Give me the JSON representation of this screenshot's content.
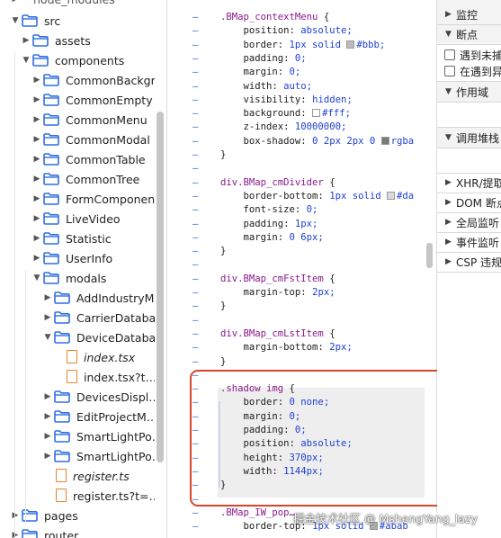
{
  "sidebar": {
    "top_partial": "node_modules",
    "items": [
      {
        "label": "src",
        "type": "folder",
        "expanded": true
      },
      {
        "label": "assets",
        "type": "folder",
        "expanded": false
      },
      {
        "label": "components",
        "type": "folder",
        "expanded": true
      },
      {
        "label": "CommonBackgr…",
        "type": "folder",
        "expanded": false
      },
      {
        "label": "CommonEmpty",
        "type": "folder",
        "expanded": false
      },
      {
        "label": "CommonMenu",
        "type": "folder",
        "expanded": false
      },
      {
        "label": "CommonModal",
        "type": "folder",
        "expanded": false
      },
      {
        "label": "CommonTable",
        "type": "folder",
        "expanded": false
      },
      {
        "label": "CommonTree",
        "type": "folder",
        "expanded": false
      },
      {
        "label": "FormComponent",
        "type": "folder",
        "expanded": false
      },
      {
        "label": "LiveVideo",
        "type": "folder",
        "expanded": false
      },
      {
        "label": "Statistic",
        "type": "folder",
        "expanded": false
      },
      {
        "label": "UserInfo",
        "type": "folder",
        "expanded": false
      },
      {
        "label": "modals",
        "type": "folder",
        "expanded": true
      },
      {
        "label": "AddIndustryM…",
        "type": "folder",
        "expanded": false
      },
      {
        "label": "CarrierDataba…",
        "type": "folder",
        "expanded": false
      },
      {
        "label": "DeviceDataba…",
        "type": "folder",
        "expanded": true
      },
      {
        "label": "index.tsx",
        "type": "file",
        "italic": true
      },
      {
        "label": "index.tsx?t…",
        "type": "file",
        "italic": false
      },
      {
        "label": "DevicesDispl…",
        "type": "folder",
        "expanded": false
      },
      {
        "label": "EditProjectM…",
        "type": "folder",
        "expanded": false
      },
      {
        "label": "SmartLightPo…",
        "type": "folder",
        "expanded": false
      },
      {
        "label": "SmartLightPo…",
        "type": "folder",
        "expanded": false
      },
      {
        "label": "register.ts",
        "type": "file",
        "italic": true
      },
      {
        "label": "register.ts?t=…",
        "type": "file",
        "italic": false
      },
      {
        "label": "pages",
        "type": "folder",
        "expanded": false
      },
      {
        "label": "router",
        "type": "folder",
        "expanded": false
      }
    ]
  },
  "code": {
    "lines": [
      {
        "m": "–",
        "t": ".BMap_contextMenu {",
        "kind": "sel"
      },
      {
        "m": "–",
        "t": "    position: absolute;",
        "kind": "prop",
        "p": "position",
        "v": "absolute"
      },
      {
        "m": "–",
        "t": "    border: 1px solid #bbb;",
        "kind": "prop",
        "p": "border",
        "v": "1px solid",
        "sw": "#bbbbbb",
        "v2": "#bbb;"
      },
      {
        "m": "–",
        "t": "    padding: 0;",
        "kind": "prop",
        "p": "padding",
        "v": "0"
      },
      {
        "m": "–",
        "t": "    margin: 0;",
        "kind": "prop",
        "p": "margin",
        "v": "0"
      },
      {
        "m": "–",
        "t": "    width: auto;",
        "kind": "prop",
        "p": "width",
        "v": "auto"
      },
      {
        "m": "–",
        "t": "    visibility: hidden;",
        "kind": "prop",
        "p": "visibility",
        "v": "hidden"
      },
      {
        "m": "–",
        "t": "    background: #fff;",
        "kind": "prop",
        "p": "background",
        "v": "",
        "sw": "#ffffff",
        "v2": "#fff;"
      },
      {
        "m": "–",
        "t": "    z-index: 10000000;",
        "kind": "prop",
        "p": "z-index",
        "v": "10000000"
      },
      {
        "m": "–",
        "t": "    box-shadow: 0 2px 2px 0 rgba",
        "kind": "prop",
        "p": "box-shadow",
        "v": "0 2px 2px 0",
        "sw": "#7a7a7a",
        "v2": "rgba"
      },
      {
        "m": "–",
        "t": "}",
        "kind": "plain"
      },
      {
        "m": "–",
        "t": "",
        "kind": "plain"
      },
      {
        "m": "–",
        "t": "div.BMap_cmDivider {",
        "kind": "sel"
      },
      {
        "m": "–",
        "t": "    border-bottom: 1px solid #da",
        "kind": "prop",
        "p": "border-bottom",
        "v": "1px solid",
        "sw": "#dadada",
        "v2": "#da"
      },
      {
        "m": "–",
        "t": "    font-size: 0;",
        "kind": "prop",
        "p": "font-size",
        "v": "0"
      },
      {
        "m": "–",
        "t": "    padding: 1px;",
        "kind": "prop",
        "p": "padding",
        "v": "1px"
      },
      {
        "m": "–",
        "t": "    margin: 0 6px;",
        "kind": "prop",
        "p": "margin",
        "v": "0 6px"
      },
      {
        "m": "–",
        "t": "}",
        "kind": "plain"
      },
      {
        "m": "–",
        "t": "",
        "kind": "plain"
      },
      {
        "m": "–",
        "t": "div.BMap_cmFstItem {",
        "kind": "sel"
      },
      {
        "m": "–",
        "t": "    margin-top: 2px;",
        "kind": "prop",
        "p": "margin-top",
        "v": "2px"
      },
      {
        "m": "–",
        "t": "}",
        "kind": "plain"
      },
      {
        "m": "–",
        "t": "",
        "kind": "plain"
      },
      {
        "m": "–",
        "t": "div.BMap_cmLstItem {",
        "kind": "sel"
      },
      {
        "m": "–",
        "t": "    margin-bottom: 2px;",
        "kind": "prop",
        "p": "margin-bottom",
        "v": "2px"
      },
      {
        "m": "–",
        "t": "}",
        "kind": "plain"
      },
      {
        "m": "–",
        "t": "",
        "kind": "plain"
      },
      {
        "m": "–",
        "t": ".shadow img {",
        "kind": "sel"
      },
      {
        "m": "–",
        "t": "    border: 0 none;",
        "kind": "prop",
        "p": "border",
        "v": "0 none"
      },
      {
        "m": "–",
        "t": "    margin: 0;",
        "kind": "prop",
        "p": "margin",
        "v": "0"
      },
      {
        "m": "–",
        "t": "    padding: 0;",
        "kind": "prop",
        "p": "padding",
        "v": "0"
      },
      {
        "m": "–",
        "t": "    position: absolute;",
        "kind": "prop",
        "p": "position",
        "v": "absolute"
      },
      {
        "m": "–",
        "t": "    height: 370px;",
        "kind": "prop",
        "p": "height",
        "v": "370px"
      },
      {
        "m": "–",
        "t": "    width: 1144px;",
        "kind": "prop",
        "p": "width",
        "v": "1144px"
      },
      {
        "m": "–",
        "t": "}",
        "kind": "plain"
      },
      {
        "m": "–",
        "t": "",
        "kind": "plain"
      },
      {
        "m": "–",
        "t": ".BMap_IW_pop…",
        "kind": "sel"
      },
      {
        "m": "–",
        "t": "    border-top: 1px solid #abab",
        "kind": "prop",
        "p": "border-top",
        "v": "1px solid",
        "sw": "#ababab",
        "v2": "#abab"
      }
    ]
  },
  "right_panel": {
    "watch": "监控",
    "breakpoints": "断点",
    "pause_uncaught": "遇到未捕",
    "pause_caught": "在遇到异",
    "scope": "作用域",
    "call_stack": "调用堆栈",
    "xhr": "XHR/提取",
    "dom": "DOM 断点",
    "global": "全局监听",
    "event": "事件监听",
    "csp": "CSP 违规"
  },
  "watermark": "掘金技术社区 @ MshengYang_lazy",
  "colors": {
    "accent_red": "#d9442c",
    "selector": "#8a1a8a",
    "value": "#1f3fd4",
    "diff_marker": "#2a6fd6",
    "folder_blue": "#2f6fe0",
    "file_orange": "#e8842c"
  }
}
